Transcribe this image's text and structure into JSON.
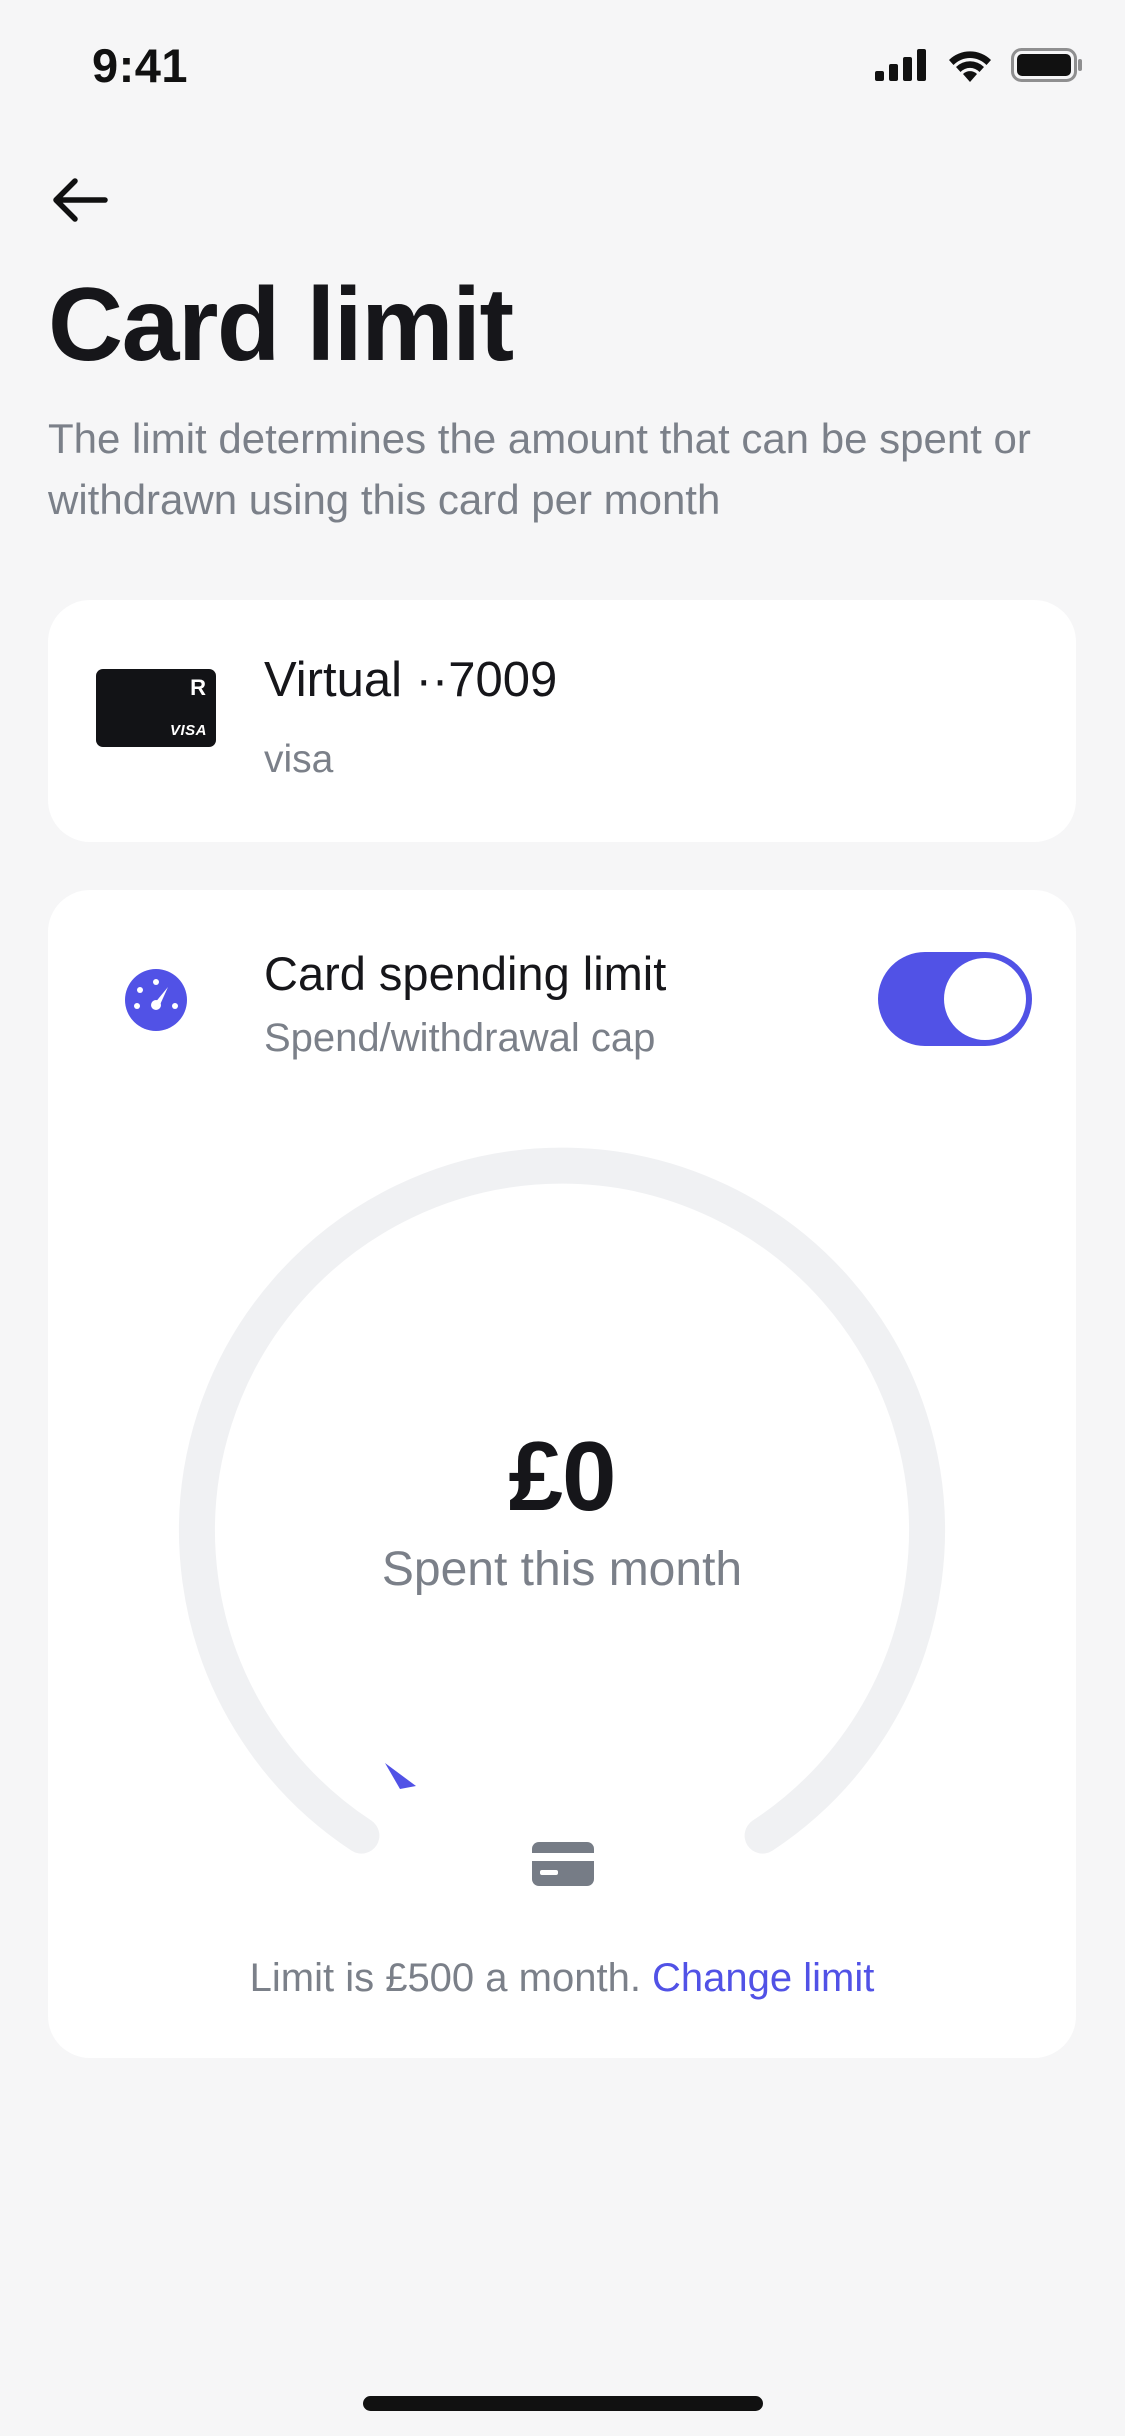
{
  "status_bar": {
    "time": "9:41"
  },
  "header": {
    "title": "Card limit",
    "description": "The limit determines the amount that can be spent or withdrawn using this card per month"
  },
  "card": {
    "thumb_logo": "R",
    "thumb_network": "VISA",
    "name": "Virtual ··7009",
    "network": "visa"
  },
  "limit": {
    "title": "Card spending limit",
    "subtitle": "Spend/withdrawal cap",
    "toggle_on": true,
    "spent_amount": "£0",
    "spent_label": "Spent this month",
    "spent_fraction": 0,
    "footer_text": "Limit is £500 a month.",
    "change_link": "Change limit"
  },
  "colors": {
    "accent": "#5152e6",
    "background": "#f6f6f7",
    "panel": "#ffffff",
    "muted_text": "#7b8089",
    "track": "#f0f1f3"
  },
  "icons": {
    "back": "arrow-left-icon",
    "limit": "speedometer-icon",
    "gauge_bottom": "credit-card-icon"
  }
}
